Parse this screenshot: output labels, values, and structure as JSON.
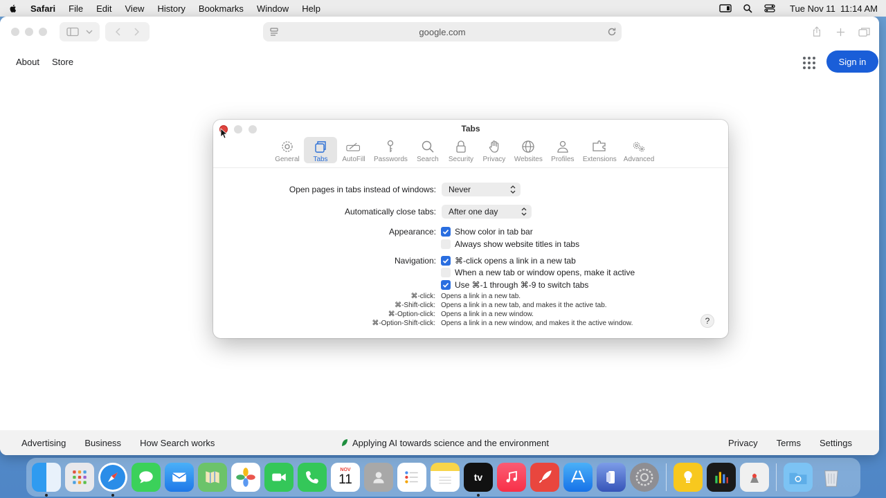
{
  "menubar": {
    "app_name": "Safari",
    "items": [
      "File",
      "Edit",
      "View",
      "History",
      "Bookmarks",
      "Window",
      "Help"
    ],
    "datetime": "Tue Nov 11  11:14 AM"
  },
  "browser": {
    "url": "google.com"
  },
  "google": {
    "top_links": [
      "About",
      "Store"
    ],
    "signin_label": "Sign in",
    "footer_left": [
      "Advertising",
      "Business",
      "How Search works"
    ],
    "footer_center": "Applying AI towards science and the environment",
    "footer_right": [
      "Privacy",
      "Terms",
      "Settings"
    ]
  },
  "dialog": {
    "title": "Tabs",
    "tabs": [
      {
        "label": "General",
        "icon": "gear-icon"
      },
      {
        "label": "Tabs",
        "icon": "tabs-icon",
        "active": true
      },
      {
        "label": "AutoFill",
        "icon": "autofill-icon"
      },
      {
        "label": "Passwords",
        "icon": "key-icon"
      },
      {
        "label": "Search",
        "icon": "search-icon"
      },
      {
        "label": "Security",
        "icon": "lock-icon"
      },
      {
        "label": "Privacy",
        "icon": "hand-icon"
      },
      {
        "label": "Websites",
        "icon": "globe-icon"
      },
      {
        "label": "Profiles",
        "icon": "person-icon"
      },
      {
        "label": "Extensions",
        "icon": "puzzle-icon"
      },
      {
        "label": "Advanced",
        "icon": "gears-icon"
      }
    ],
    "open_pages_label": "Open pages in tabs instead of windows:",
    "open_pages_value": "Never",
    "auto_close_label": "Automatically close tabs:",
    "auto_close_value": "After one day",
    "appearance_label": "Appearance:",
    "show_color_label": "Show color in tab bar",
    "show_titles_label": "Always show website titles in tabs",
    "navigation_label": "Navigation:",
    "cmd_click_label": "⌘-click opens a link in a new tab",
    "new_tab_active_label": "When a new tab or window opens, make it active",
    "cmd_num_label": "Use ⌘-1 through ⌘-9 to switch tabs",
    "hints": [
      {
        "key": "⌘-click:",
        "desc": "Opens a link in a new tab."
      },
      {
        "key": "⌘-Shift-click:",
        "desc": "Opens a link in a new tab, and makes it the active tab."
      },
      {
        "key": "⌘-Option-click:",
        "desc": "Opens a link in a new window."
      },
      {
        "key": "⌘-Option-Shift-click:",
        "desc": "Opens a link in a new window, and makes it the active window."
      }
    ],
    "help_label": "?"
  },
  "dock": {
    "calendar_month": "NOV",
    "calendar_day": "11",
    "tv_label": "tv",
    "apps": [
      "finder",
      "launchpad",
      "safari",
      "messages",
      "mail",
      "maps",
      "photos",
      "facetime",
      "phone",
      "calendar",
      "contacts",
      "reminders",
      "notes",
      "tv",
      "music",
      "rocket",
      "app-store",
      "iphone-mirroring",
      "system-settings",
      "tips",
      "graphing",
      "preview",
      "downloads",
      "trash"
    ]
  }
}
